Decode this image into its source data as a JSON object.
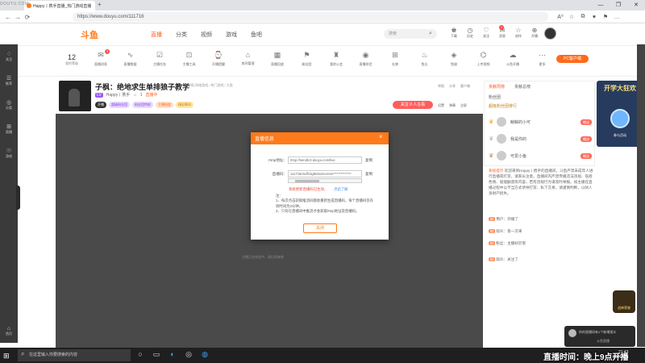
{
  "browser": {
    "tab_title": "Happy丨携手直播_热门游戏直播",
    "new_tab": "+",
    "url": "https://www.douyu.com/111716",
    "controls": [
      "—",
      "❐",
      "✕"
    ],
    "nav": [
      "←",
      "→",
      "⟳"
    ],
    "addr_icons": [
      "A⁰",
      "☆",
      "⧉",
      "♥",
      "⚑",
      "…"
    ]
  },
  "left_overlay": {
    "tag": "DOUYU.COM",
    "items": [
      {
        "icon": "♢",
        "label": "关注"
      },
      {
        "icon": "☰",
        "label": "推荐"
      },
      {
        "icon": "◎",
        "label": "分类"
      },
      {
        "icon": "⊞",
        "label": "直播"
      },
      {
        "icon": "☉",
        "label": "游戏"
      }
    ],
    "bottom": {
      "icon": "⌂",
      "label": "首页"
    }
  },
  "site": {
    "logo": "斗鱼",
    "nav": [
      "直播",
      "分类",
      "视频",
      "游戏",
      "鱼吧"
    ],
    "nav_active_index": 0,
    "search_placeholder": "搜索",
    "header_icons": [
      {
        "icon": "♚",
        "label": "下载"
      },
      {
        "icon": "◷",
        "label": "历史"
      },
      {
        "icon": "♡",
        "label": "关注"
      },
      {
        "icon": "✉",
        "label": "消息"
      },
      {
        "icon": "☆",
        "label": "创作"
      },
      {
        "icon": "⊕",
        "label": "开播"
      }
    ],
    "header_badge": "1"
  },
  "toolbar": {
    "level_value": "12",
    "level_label": "我的等级",
    "badge": "3",
    "items": [
      {
        "icon": "✉",
        "label": "直播消息"
      },
      {
        "icon": "∿",
        "label": "直播数据"
      },
      {
        "icon": "☑",
        "label": "主播任务"
      },
      {
        "icon": "⊡",
        "label": "主播工具"
      },
      {
        "icon": "⌚",
        "label": "开播提醒"
      },
      {
        "icon": "⌂",
        "label": "房间管理"
      },
      {
        "icon": "▦",
        "label": "直播回放"
      },
      {
        "icon": "⚑",
        "label": "粉丝团"
      },
      {
        "icon": "♜",
        "label": "我的公会"
      },
      {
        "icon": "◉",
        "label": "直播伴侣"
      },
      {
        "icon": "⊞",
        "label": "礼物"
      },
      {
        "icon": "♨",
        "label": "鱼丸"
      },
      {
        "icon": "◈",
        "label": "鱼翅"
      },
      {
        "icon": "⌬",
        "label": "上传视频"
      },
      {
        "icon": "☁",
        "label": "斗鱼开播"
      },
      {
        "icon": "⋯",
        "label": "更多"
      }
    ],
    "pc_button": "PC客户端"
  },
  "room": {
    "title": "子枫：绝地求生单排狼子教学",
    "meta": "举报  网络游戏 / 热门游戏 / 大类",
    "level_badge": "LV",
    "streamer": "Happy丨携手",
    "heat": "1",
    "live_status": "直播中",
    "tags": [
      {
        "text": "开播",
        "style": "tag-dark"
      },
      {
        "text": "超级粉丝团",
        "style": "tag-purple"
      },
      {
        "text": "粉丝团特权",
        "style": "tag-purple"
      },
      {
        "text": "主播热度",
        "style": "tag-orange"
      },
      {
        "text": "精彩瞬间",
        "style": "tag-yellow"
      }
    ],
    "follow_button": "关注 0 人在看",
    "report_links": [
      "举报",
      "分享",
      "客户端"
    ],
    "share_links": [
      "设置",
      "弹幕",
      "全屏"
    ]
  },
  "video": {
    "hint": "主播正在休息中，稍后再来吧"
  },
  "right": {
    "rank_tabs": [
      "贡献周榜",
      "贡献总榜"
    ],
    "rank_sub": "粉丝团",
    "rank_sub2": "超级粉丝团排行",
    "rank_items": [
      {
        "name": "鲸鲸的小可",
        "btn": "赠送"
      },
      {
        "name": "我是你的",
        "btn": "赠送"
      },
      {
        "name": "可爱小鱼",
        "btn": "赠送"
      }
    ],
    "promo_title": "开学大狂欢",
    "promo_foot": "参与活动",
    "chat": [
      {
        "tag": "系统提示",
        "text": "欢迎来到Happy丨携手的直播间，斗鱼严禁未成年人进行直播或打赏，请家长注意。直播间内严禁传播违法违规、低俗色情、吸烟酗酒等内容，若有违规行为请及时举报。如主播在直播过程中以不当方式诱导打赏、私下交易，请谨慎判断，以防人身财产损失。"
      },
      {
        "tag": "",
        "text": "用户：开播了"
      },
      {
        "tag": "",
        "text": "观众：第一次来"
      },
      {
        "tag": "",
        "text": "粉丝：主播好厉害"
      },
      {
        "tag": "",
        "text": "观众：关注了"
      }
    ],
    "champion": "战神荣誉"
  },
  "dialog": {
    "title": "直播信息",
    "rtmp_label": "rtmp地址：",
    "rtmp_value": "rtmp://sendtc3.douyu.com/live",
    "copy1": "复制",
    "key_label": "直播码：",
    "key_value": "111716rrsdfr1lg8s3w3ccnetv**************",
    "copy2": "复制",
    "warn": "系统更新直播码已生效，",
    "learn": "点此了解",
    "notes_title": "注：",
    "notes": [
      "1、每次点击获取推流码都会重新生成直播码，每个直播码仅有效时间为2分钟。",
      "2、只有在直播间中推流才会获取rtmp地址及直播码。"
    ],
    "close": "关闭"
  },
  "notification": {
    "text": "你的直播间有1个新增观众",
    "title": "斗鱼直播"
  },
  "caption": "直播时间：晚上9点开播",
  "taskbar": {
    "start": "⊞",
    "search_placeholder": "在这里输入你要搜索的内容",
    "search_icon": "⌕",
    "apps": [
      "○",
      "▭",
      "◐",
      "◎",
      "◍"
    ],
    "tray": "^ ◖ 英",
    "time": "21:43",
    "date": "2021/9/4"
  },
  "colors": {
    "accent": "#ff7a1a",
    "brand_red": "#ff5d23",
    "video_bg": "#4a4a4a"
  }
}
